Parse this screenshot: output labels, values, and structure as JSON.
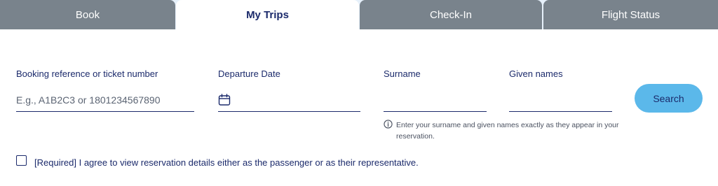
{
  "tabs": [
    {
      "label": "Book"
    },
    {
      "label": "My Trips"
    },
    {
      "label": "Check-In"
    },
    {
      "label": "Flight Status"
    }
  ],
  "active_tab": "My Trips",
  "form": {
    "booking_ref_label": "Booking reference or ticket number",
    "booking_ref_placeholder": "E.g., A1B2C3 or 1801234567890",
    "departure_date_label": "Departure Date",
    "departure_date_icon": "calendar-icon",
    "surname_label": "Surname",
    "given_names_label": "Given names",
    "search_label": "Search",
    "hint": "Enter your surname and given names exactly as they appear in your reservation.",
    "hint_icon": "info-icon",
    "agree_label": "[Required] I agree to view reservation details either as the passenger or as their representative."
  },
  "colors": {
    "tab_inactive": "#79838c",
    "tab_active_text": "#1b2a6b",
    "accent_button": "#5bb8ea",
    "text_primary": "#1b2a6b"
  }
}
